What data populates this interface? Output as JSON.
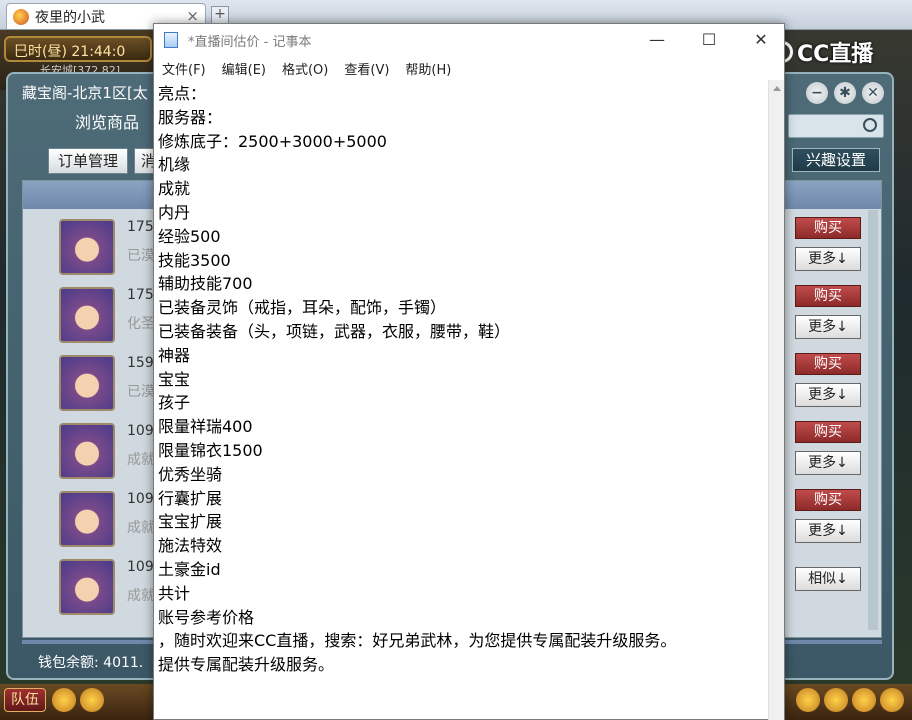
{
  "browser": {
    "tab_title": "夜里的小武",
    "tab_close": "×",
    "new_tab": "+"
  },
  "game": {
    "time_label": "巳时(昼)  21:44:0",
    "coords": "长安城[372,82]",
    "cc_brand": "CC直播",
    "team_button": "队伍"
  },
  "shop": {
    "title": "藏宝阁-北京1区[太",
    "browse_tab": "浏览商品",
    "order_button": "订单管理",
    "order_button2": "消",
    "interest_button": "兴趣设置",
    "wallet": "钱包余额: 4011.",
    "items": [
      {
        "line1": "175",
        "line2": "已漠",
        "buy": "购买",
        "more": "更多↓"
      },
      {
        "line1": "175",
        "line2": "化圣",
        "buy": "购买",
        "more": "更多↓"
      },
      {
        "line1": "159",
        "line2": "已漠",
        "buy": "购买",
        "more": "更多↓"
      },
      {
        "line1": "109",
        "line2": "成就",
        "buy": "购买",
        "more": "更多↓"
      },
      {
        "line1": "109",
        "line2": "成就",
        "buy": "购买",
        "more": "更多↓"
      },
      {
        "line1": "109",
        "line2": "成就",
        "buy": "",
        "more": "相似↓"
      }
    ]
  },
  "notepad": {
    "title": "*直播间估价 - 记事本",
    "menu": [
      "文件(F)",
      "编辑(E)",
      "格式(O)",
      "查看(V)",
      "帮助(H)"
    ],
    "minimize": "—",
    "maximize": "☐",
    "close": "✕",
    "lines": [
      "亮点：",
      "服务器：",
      "修炼底子：2500+3000+5000",
      "机缘",
      "成就",
      "内丹",
      "经验500",
      "技能3500",
      "辅助技能700",
      "已装备灵饰（戒指，耳朵，配饰，手镯）",
      "已装备装备（头，项链，武器，衣服，腰带，鞋）",
      "神器",
      "宝宝",
      "孩子",
      "限量祥瑞400",
      "限量锦衣1500",
      "优秀坐骑",
      "行囊扩展",
      "宝宝扩展",
      "施法特效",
      "土豪金id",
      "共计",
      "账号参考价格",
      "，随时欢迎来CC直播，搜索：好兄弟武林，为您提供专属配装升级服务。",
      "提供专属配装升级服务。"
    ]
  }
}
